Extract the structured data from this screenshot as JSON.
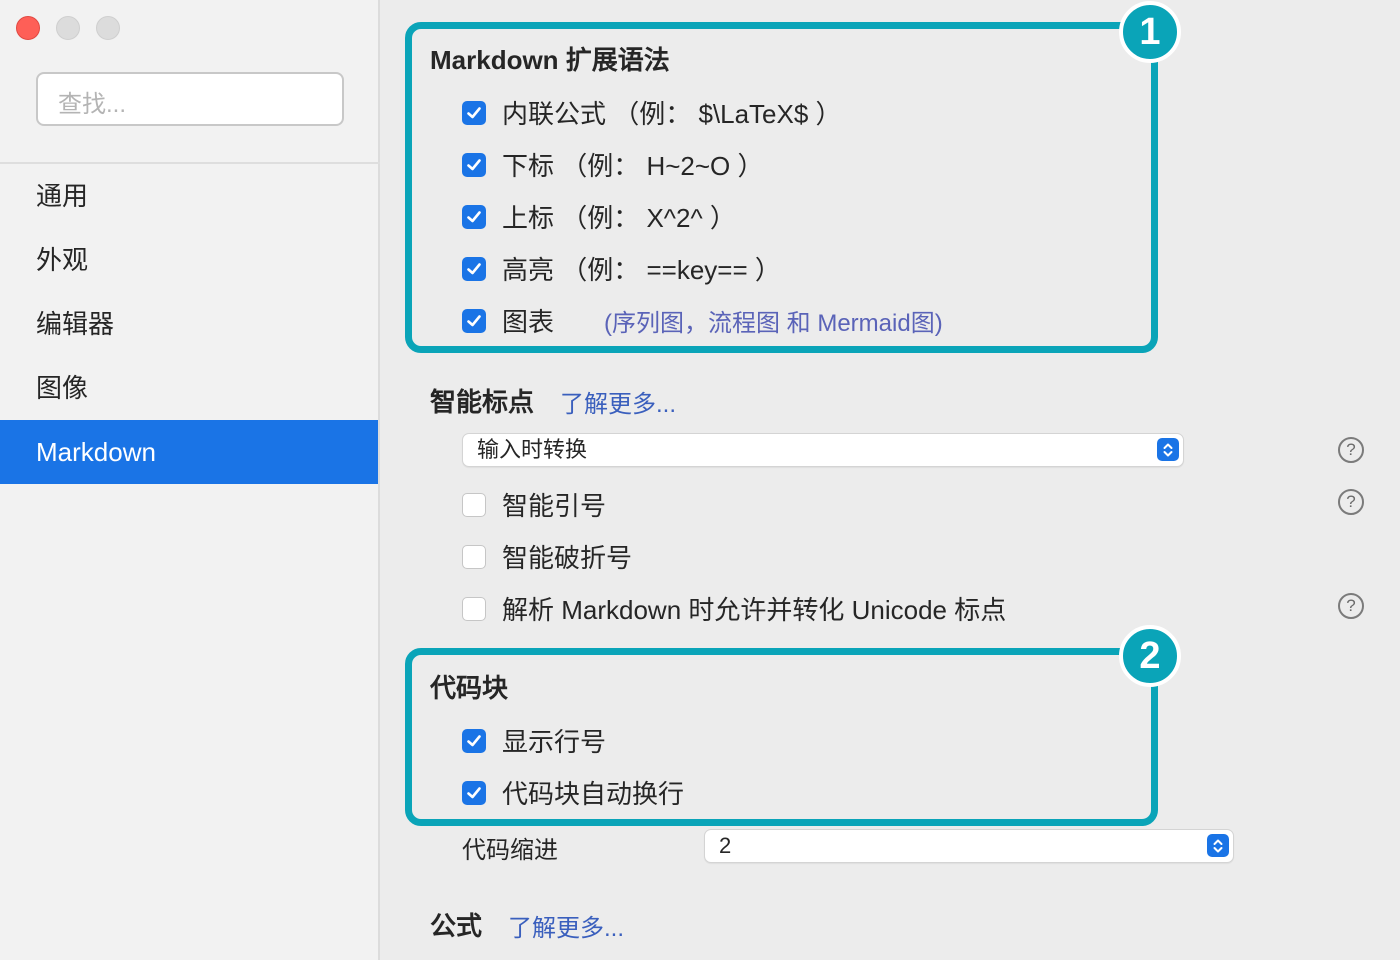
{
  "sidebar": {
    "search_placeholder": "查找...",
    "items": [
      {
        "label": "通用"
      },
      {
        "label": "外观"
      },
      {
        "label": "编辑器"
      },
      {
        "label": "图像"
      },
      {
        "label": "Markdown"
      }
    ],
    "active_item": "Markdown"
  },
  "markdown_ext": {
    "title": "Markdown 扩展语法",
    "options": [
      {
        "label": "内联公式 （例： $\\LaTeX$ ）",
        "checked": true
      },
      {
        "label": "下标 （例： H~2~O ）",
        "checked": true
      },
      {
        "label": "上标 （例： X^2^ ）",
        "checked": true
      },
      {
        "label": "高亮 （例： ==key== ）",
        "checked": true
      },
      {
        "label": "图表",
        "checked": true,
        "note": "(序列图，流程图 和 Mermaid图)"
      }
    ]
  },
  "smart_punct": {
    "title": "智能标点",
    "learn_more": "了解更多...",
    "select_value": "输入时转换",
    "options": [
      {
        "label": "智能引号",
        "checked": false
      },
      {
        "label": "智能破折号",
        "checked": false
      },
      {
        "label": "解析 Markdown 时允许并转化 Unicode 标点",
        "checked": false
      }
    ]
  },
  "code_block": {
    "title": "代码块",
    "options": [
      {
        "label": "显示行号",
        "checked": true
      },
      {
        "label": "代码块自动换行",
        "checked": true
      }
    ],
    "indent_label": "代码缩进",
    "indent_value": "2"
  },
  "math": {
    "title": "公式",
    "learn_more": "了解更多..."
  },
  "annotations": [
    "1",
    "2"
  ],
  "help_icon_text": "?",
  "colors": {
    "accent": "#1a74e6",
    "annotation": "#0aa4b8",
    "link": "#3a5fbd"
  }
}
